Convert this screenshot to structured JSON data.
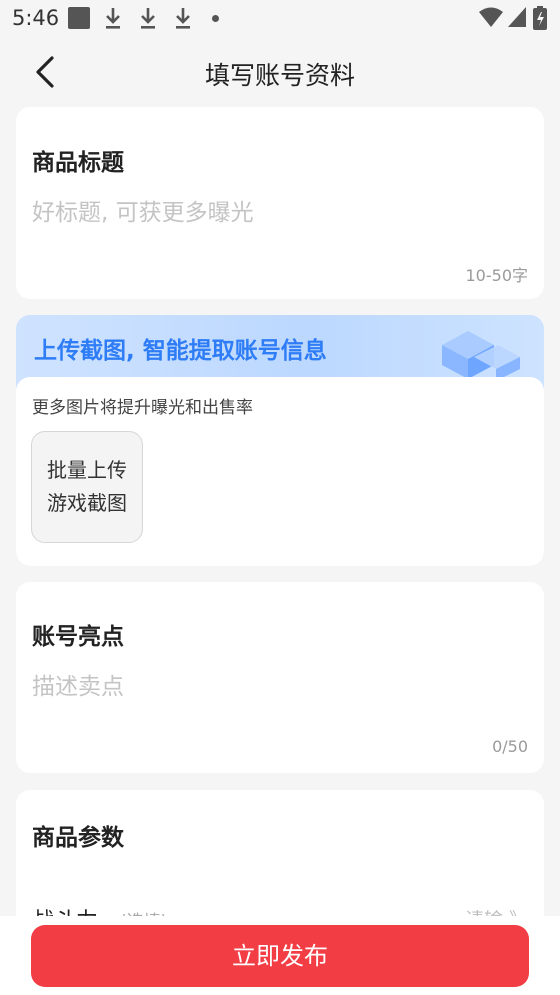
{
  "status_bar": {
    "time": "5:46",
    "icons": [
      "notification-square-icon",
      "download-icon",
      "download-icon",
      "download-icon",
      "dot-icon",
      "wifi-icon",
      "signal-icon",
      "battery-charging-icon"
    ]
  },
  "nav": {
    "title": "填写账号资料",
    "back_icon": "chevron-left-icon"
  },
  "title_card": {
    "label": "商品标题",
    "placeholder": "好标题, 可获更多曝光",
    "counter": "10-50字"
  },
  "upload_card": {
    "banner_text": "上传截图, 智能提取账号信息",
    "hint": "更多图片将提升曝光和出售率",
    "button_line1": "批量上传",
    "button_line2": "游戏截图"
  },
  "highlight_card": {
    "label": "账号亮点",
    "placeholder": "描述卖点",
    "counter": "0/50"
  },
  "params_card": {
    "label": "商品参数",
    "row_label": "战斗力",
    "row_optional": "(选填)",
    "row_value": "请输 》"
  },
  "bottom": {
    "publish_label": "立即发布"
  },
  "colors": {
    "accent": "#f23d44",
    "banner_text": "#2f7df6",
    "background": "#f5f5f5"
  }
}
